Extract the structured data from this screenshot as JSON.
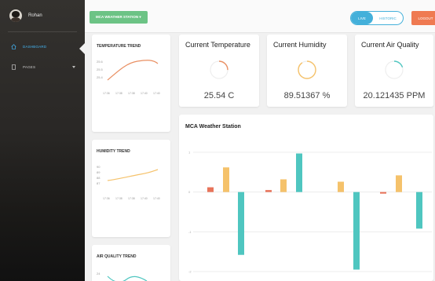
{
  "sidebar": {
    "user": "Rohan",
    "items": [
      {
        "label": "DASHBOARD",
        "icon": "home-icon"
      },
      {
        "label": "PAGES",
        "icon": "file-icon"
      }
    ]
  },
  "header": {
    "station_button": "MCA WEATHER STATION ▾",
    "toggle_live": "LIVE",
    "toggle_historic": "HISTORIC",
    "logout": "LOGOUT"
  },
  "trends": {
    "temperature": {
      "title": "TEMPERATURE TREND",
      "yticks": [
        "25.6",
        "25.5",
        "25.4"
      ],
      "xticks": [
        "17:36",
        "17:38",
        "17:38",
        "17:40",
        "17:40"
      ],
      "color": "#e98f62"
    },
    "humidity": {
      "title": "HUMIDITY TREND",
      "yticks": [
        "90",
        "89",
        "88",
        "87"
      ],
      "xticks": [
        "17:36",
        "17:38",
        "17:38",
        "17:40",
        "17:40"
      ],
      "color": "#f5c26b"
    },
    "air_quality": {
      "title": "AIR QUALITY TREND",
      "yticks": [
        "24"
      ],
      "color": "#4fc6c0"
    }
  },
  "metrics": [
    {
      "title": "Current Temperature",
      "value": "25.54 C",
      "color": "#e98f62",
      "level": 0.25
    },
    {
      "title": "Current Humidity",
      "value": "89.51367 %",
      "color": "#f5c26b",
      "level": 0.9
    },
    {
      "title": "Current Air Quality",
      "value": "20.121435 PPM",
      "color": "#4fc6c0",
      "level": 0.2
    }
  ],
  "station_chart": {
    "title": "MCA Weather Station"
  },
  "chart_data": {
    "type": "bar",
    "title": "MCA Weather Station",
    "yticks": [
      "1",
      "0",
      "-1",
      "-2"
    ],
    "ylim": [
      -2,
      1
    ],
    "grid": true,
    "series": [
      {
        "color": "#e8745a",
        "values": [
          0.12,
          0.05,
          -0.04
        ]
      },
      {
        "color": "#f5c26b",
        "values": [
          0.62,
          0.32,
          0.26,
          0.42
        ]
      },
      {
        "color": "#4fc6c0",
        "values": [
          -1.58,
          0.97,
          -1.95,
          -0.92
        ]
      }
    ]
  }
}
